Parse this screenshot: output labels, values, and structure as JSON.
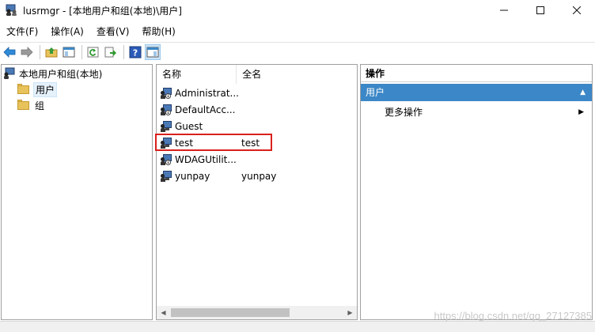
{
  "window": {
    "title": "lusrmgr - [本地用户和组(本地)\\用户]",
    "minimize": "—",
    "maximize": "☐",
    "close": "✕"
  },
  "menu": {
    "items": [
      "文件(F)",
      "操作(A)",
      "查看(V)",
      "帮助(H)"
    ]
  },
  "toolbar": {
    "buttons": [
      "back-icon",
      "forward-icon",
      "up-folder-icon",
      "show-hide-tree-icon",
      "refresh-icon",
      "export-list-icon",
      "help-icon",
      "show-hide-action-pane-icon"
    ]
  },
  "tree": {
    "root": "本地用户和组(本地)",
    "children": [
      "用户",
      "组"
    ],
    "selected": "用户"
  },
  "list": {
    "columns": [
      "名称",
      "全名"
    ],
    "rows": [
      {
        "name": "Administrat...",
        "full": "",
        "disabled": true
      },
      {
        "name": "DefaultAcc...",
        "full": "",
        "disabled": true
      },
      {
        "name": "Guest",
        "full": "",
        "disabled": false
      },
      {
        "name": "test",
        "full": "test",
        "disabled": false,
        "highlighted": true
      },
      {
        "name": "WDAGUtilit...",
        "full": "",
        "disabled": true
      },
      {
        "name": "yunpay",
        "full": "yunpay",
        "disabled": false
      }
    ]
  },
  "actions": {
    "header": "操作",
    "section": "用户",
    "section_toggle": "▲",
    "item": "更多操作",
    "item_arrow": "▶"
  },
  "watermark": "https://blog.csdn.net/qq_27127385",
  "colors": {
    "section_bg": "#3c87c7",
    "highlight_border": "#d9201c",
    "selected_bg": "#e5f1fb"
  }
}
